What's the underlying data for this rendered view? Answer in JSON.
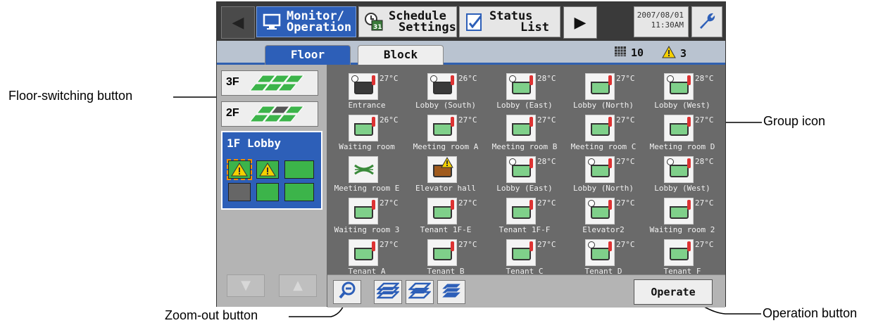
{
  "callouts": {
    "floor_switching": "Floor-switching button",
    "group_icon": "Group icon",
    "zoom_out": "Zoom-out button",
    "operation": "Operation button"
  },
  "topbar": {
    "monitor_label_1": "Monitor/",
    "monitor_label_2": "Operation",
    "schedule_label_1": "Schedule",
    "schedule_label_2": "Settings",
    "status_label_1": "Status",
    "status_label_2": "List",
    "date": "2007/08/01",
    "time": "11:30AM"
  },
  "tabs": {
    "floor": "Floor",
    "block": "Block",
    "grid_count": "10",
    "warning_count": "3"
  },
  "floors": [
    {
      "label": "3F"
    },
    {
      "label": "2F"
    }
  ],
  "selected_floor": {
    "label": "1F Lobby"
  },
  "groups": [
    {
      "name": "Entrance",
      "temp": "27°C",
      "style": "dark",
      "timer": true
    },
    {
      "name": "Lobby (South)",
      "temp": "26°C",
      "style": "dark",
      "timer": true
    },
    {
      "name": "Lobby (East)",
      "temp": "28°C",
      "style": "green",
      "timer": true
    },
    {
      "name": "Lobby (North)",
      "temp": "27°C",
      "style": "green",
      "timer": false
    },
    {
      "name": "Lobby (West)",
      "temp": "28°C",
      "style": "green",
      "timer": true
    },
    {
      "name": "Waiting room",
      "temp": "26°C",
      "style": "green",
      "timer": false
    },
    {
      "name": "Meeting room A",
      "temp": "27°C",
      "style": "green",
      "timer": false
    },
    {
      "name": "Meeting room B",
      "temp": "27°C",
      "style": "green",
      "timer": false
    },
    {
      "name": "Meeting room C",
      "temp": "27°C",
      "style": "green",
      "timer": false
    },
    {
      "name": "Meeting room D",
      "temp": "27°C",
      "style": "green",
      "timer": false
    },
    {
      "name": "Meeting room E",
      "temp": "",
      "style": "vent",
      "timer": false
    },
    {
      "name": "Elevator hall",
      "temp": "",
      "style": "brown",
      "timer": false
    },
    {
      "name": "Lobby (East)",
      "temp": "28°C",
      "style": "green",
      "timer": true
    },
    {
      "name": "Lobby (North)",
      "temp": "27°C",
      "style": "green",
      "timer": true
    },
    {
      "name": "Lobby (West)",
      "temp": "28°C",
      "style": "green",
      "timer": true
    },
    {
      "name": "Waiting room 3",
      "temp": "27°C",
      "style": "green",
      "timer": false
    },
    {
      "name": "Tenant 1F-E",
      "temp": "27°C",
      "style": "green",
      "timer": false
    },
    {
      "name": "Tenant 1F-F",
      "temp": "27°C",
      "style": "green",
      "timer": false
    },
    {
      "name": "Elevator2",
      "temp": "27°C",
      "style": "green",
      "timer": true
    },
    {
      "name": "Waiting room 2",
      "temp": "27°C",
      "style": "green",
      "timer": false
    },
    {
      "name": "Tenant A",
      "temp": "27°C",
      "style": "green",
      "timer": false
    },
    {
      "name": "Tenant B",
      "temp": "27°C",
      "style": "green",
      "timer": false
    },
    {
      "name": "Tenant C",
      "temp": "27°C",
      "style": "green",
      "timer": false
    },
    {
      "name": "Tenant D",
      "temp": "27°C",
      "style": "green",
      "timer": true
    },
    {
      "name": "Tenant F",
      "temp": "27°C",
      "style": "green",
      "timer": false
    }
  ],
  "bottombar": {
    "operate_label": "Operate"
  },
  "colors": {
    "active_blue": "#2d5fb8",
    "unit_green": "#7fd08a",
    "warning_yellow": "#f5d000"
  }
}
